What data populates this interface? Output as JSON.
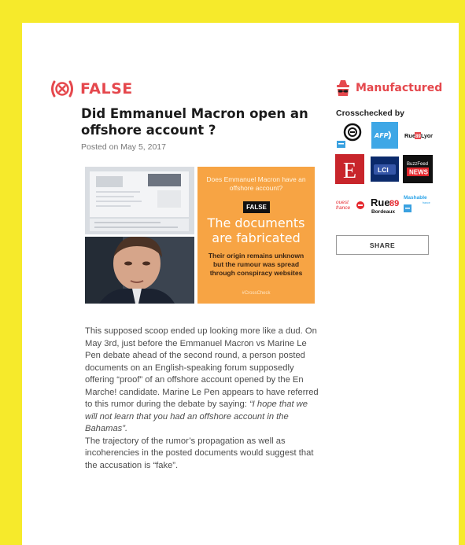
{
  "verdict": {
    "label": "FALSE",
    "icon": "x-circle-icon",
    "color": "#e5484d"
  },
  "article": {
    "title": "Did Emmanuel Macron open an offshore account ?",
    "posted": "Posted on May 5, 2017",
    "body_p1": "This supposed scoop ended up looking more like a dud. On May 3rd, just before the Emmanuel Macron vs Marine Le Pen debate ahead of the second round, a person posted documents on an English-speaking forum supposedly offering “proof” of an offshore account opened by the En Marche! candidate. Marine Le Pen appears to have referred to this rumor during the debate by saying: ",
    "body_quote": "“I hope that we will not learn that you had an offshore account in the Bahamas”.",
    "body_p2": "The trajectory of the rumor’s propagation as well as incoherencies in the posted documents would suggest that the accusation is “fake”."
  },
  "image_card": {
    "question": "Does Emmanuel Macron have an offshore account?",
    "badge": "FALSE",
    "headline": "The documents are fabricated",
    "subtext": "Their origin remains unknown but the rumour was spread through conspiracy websites",
    "brand": "#CrossCheck",
    "background": "#f7a444"
  },
  "sidebar": {
    "status_label": "Manufactured",
    "status_icon": "spy-hat-icon",
    "crosschecked_label": "Crosschecked by",
    "logos": [
      "France 24",
      "AFP",
      "Rue89 Lyon",
      "L'Express",
      "LCI",
      "BuzzFeed News",
      "Ouest-France",
      "Rue89 Bordeaux",
      "Mashable"
    ],
    "share_label": "SHARE"
  },
  "colors": {
    "page_border": "#f6ea2b",
    "accent": "#e5484d"
  }
}
